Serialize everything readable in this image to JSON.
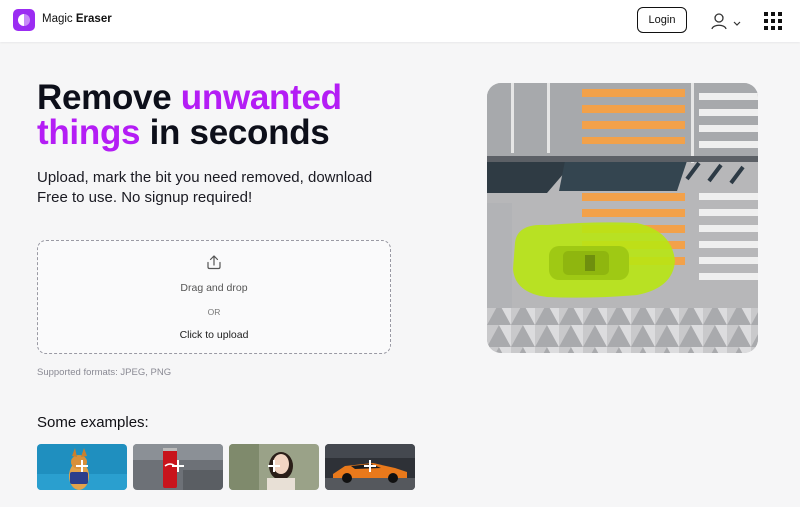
{
  "header": {
    "brand_prefix": "Magic",
    "brand_name": "Eraser",
    "login_label": "Login",
    "brand_color": "#9b2cf2"
  },
  "hero": {
    "title_part1": "Remove ",
    "title_accent1": "unwanted",
    "title_accent2": "things",
    "title_part2": " in seconds",
    "subtitle_line1": "Upload, mark the bit you need removed, download",
    "subtitle_line2": "Free to use. No signup required!",
    "accent_color": "#b41df5"
  },
  "upload": {
    "drag_text": "Drag and drop",
    "or_text": "OR",
    "click_text": "Click to upload",
    "formats": "Supported formats: JPEG, PNG"
  },
  "examples": {
    "title": "Some examples:",
    "items": [
      {
        "name": "dog",
        "icon": "plus-icon"
      },
      {
        "name": "can",
        "icon": "plus-icon"
      },
      {
        "name": "woman",
        "icon": "plus-icon"
      },
      {
        "name": "car",
        "icon": "plus-icon"
      }
    ]
  },
  "icons": {
    "account": "user-icon",
    "apps": "grid-icon",
    "upload": "upload-icon"
  }
}
